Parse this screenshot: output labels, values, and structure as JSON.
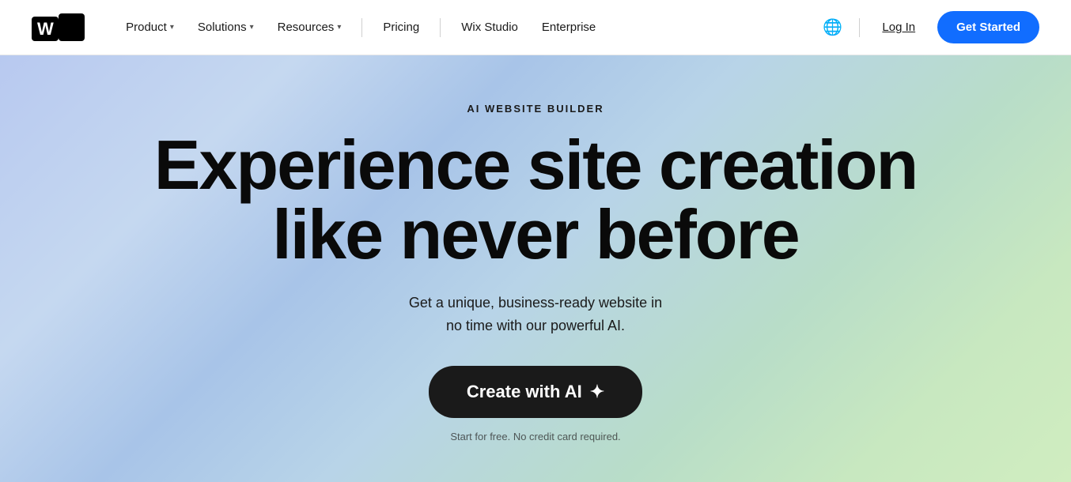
{
  "nav": {
    "logo_text": "wix",
    "items": [
      {
        "label": "Product",
        "has_dropdown": true
      },
      {
        "label": "Solutions",
        "has_dropdown": true
      },
      {
        "label": "Resources",
        "has_dropdown": true
      },
      {
        "label": "Pricing",
        "has_dropdown": false
      },
      {
        "label": "Wix Studio",
        "has_dropdown": false
      },
      {
        "label": "Enterprise",
        "has_dropdown": false
      }
    ],
    "login_label": "Log In",
    "get_started_label": "Get Started"
  },
  "hero": {
    "eyebrow": "AI WEBSITE BUILDER",
    "title_line1": "Experience site creation",
    "title_line2": "like never before",
    "subtitle_line1": "Get a unique, business-ready website in",
    "subtitle_line2": "no time with our powerful AI.",
    "cta_label": "Create with AI",
    "disclaimer": "Start for free. No credit card required."
  },
  "icons": {
    "chevron": "▾",
    "globe": "🌐",
    "sparkle": "✦"
  }
}
